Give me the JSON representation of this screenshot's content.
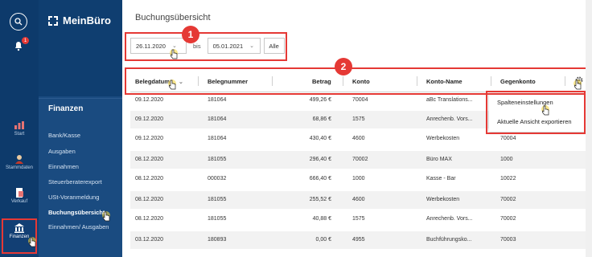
{
  "app": {
    "name": "MeinBüro"
  },
  "rail": {
    "badge_count": "1",
    "items": [
      {
        "label": "Start"
      },
      {
        "label": "Stammdaten"
      },
      {
        "label": "Verkauf"
      },
      {
        "label": "Finanzen"
      }
    ]
  },
  "sidebar": {
    "section": "Finanzen",
    "items": [
      {
        "label": "Bank/Kasse"
      },
      {
        "label": "Ausgaben"
      },
      {
        "label": "Einnahmen"
      },
      {
        "label": "Steuerberaterexport"
      },
      {
        "label": "USt-Voranmeldung"
      },
      {
        "label": "Buchungsübersicht"
      },
      {
        "label": "Einnahmen/ Ausgaben"
      }
    ]
  },
  "main": {
    "title": "Buchungsübersicht",
    "filter": {
      "from": "26.11.2020",
      "separator": "bis",
      "to": "05.01.2021",
      "all_label": "Alle"
    }
  },
  "annotations": [
    "1",
    "2"
  ],
  "table": {
    "columns": [
      "Belegdatum",
      "Belegnummer",
      "Betrag",
      "Konto",
      "Konto-Name",
      "Gegenkonto"
    ],
    "rows": [
      [
        "09.12.2020",
        "181064",
        "499,26 €",
        "70004",
        "aBc Translations...",
        ""
      ],
      [
        "09.12.2020",
        "181064",
        "68,86 €",
        "1575",
        "Anrechenb. Vors...",
        ""
      ],
      [
        "09.12.2020",
        "181064",
        "430,40 €",
        "4600",
        "Werbekosten",
        "70004"
      ],
      [
        "08.12.2020",
        "181055",
        "296,40 €",
        "70002",
        "Büro MAX",
        "1000"
      ],
      [
        "08.12.2020",
        "000032",
        "666,40 €",
        "1000",
        "Kasse - Bar",
        "10022"
      ],
      [
        "08.12.2020",
        "181055",
        "255,52 €",
        "4600",
        "Werbekosten",
        "70002"
      ],
      [
        "08.12.2020",
        "181055",
        "40,88 €",
        "1575",
        "Anrechenb. Vors...",
        "70002"
      ],
      [
        "03.12.2020",
        "180893",
        "0,00 €",
        "4955",
        "Buchführungsko...",
        "70003"
      ]
    ]
  },
  "column_menu": {
    "items": [
      {
        "label": "Spalteneinstellungen"
      },
      {
        "label": "Aktuelle Ansicht exportieren"
      }
    ]
  },
  "colors": {
    "rail": "#0d3a6b",
    "sidebar": "#1a4b80",
    "highlight": "#e53935"
  }
}
